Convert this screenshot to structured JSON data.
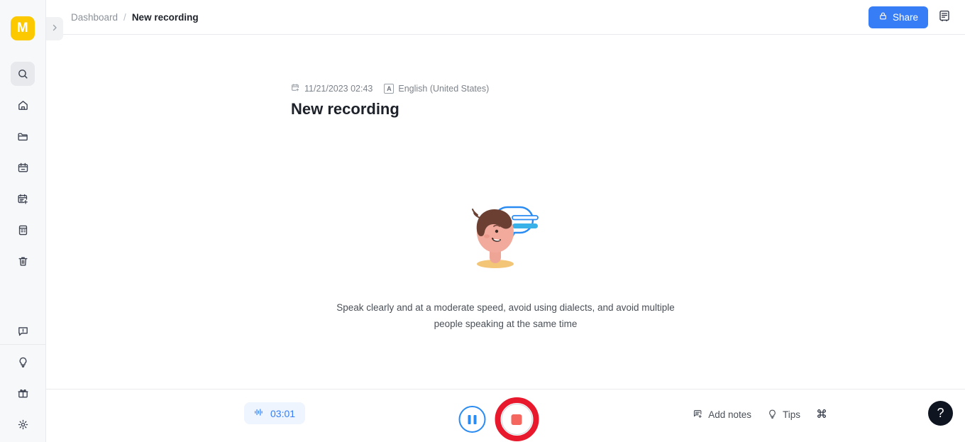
{
  "brand": {
    "logo_letter": "M",
    "logo_color": "#fcc800"
  },
  "sidebar": {
    "expand_icon": "chevron-right-icon",
    "top_items": [
      {
        "name": "search",
        "icon": "search-icon",
        "active": true
      },
      {
        "name": "home",
        "icon": "home-icon",
        "active": false
      },
      {
        "name": "folder",
        "icon": "folder-icon",
        "active": false
      },
      {
        "name": "calendar",
        "icon": "calendar-icon",
        "active": false
      },
      {
        "name": "new-meeting",
        "icon": "calendar-plus-icon",
        "active": false
      },
      {
        "name": "notes",
        "icon": "document-list-icon",
        "active": false
      },
      {
        "name": "trash",
        "icon": "trash-icon",
        "active": false
      }
    ],
    "bottom_items": [
      {
        "name": "feedback",
        "icon": "feedback-bubble-icon"
      },
      {
        "name": "whats-new",
        "icon": "lightbulb-icon"
      },
      {
        "name": "rewards",
        "icon": "gift-icon"
      },
      {
        "name": "settings",
        "icon": "gear-icon"
      }
    ]
  },
  "header": {
    "breadcrumb": {
      "root": "Dashboard",
      "separator": "/",
      "current": "New recording"
    },
    "share_label": "Share",
    "share_icon": "lock-icon",
    "share_color": "#377ef6",
    "panel_icon": "notes-panel-icon"
  },
  "recording": {
    "date": "11/21/2023 02:43",
    "date_icon": "calendar-plus-icon",
    "language": "English (United States)",
    "language_icon": "A",
    "title": "New recording",
    "hint": "Speak clearly and at a moderate speed, avoid using dialects, and avoid multiple people speaking at the same time",
    "illustration": "person-speaking-illustration"
  },
  "controls": {
    "timer": "03:01",
    "timer_icon": "waveform-icon",
    "timer_color": "#377ef6",
    "pause_label": "pause-button",
    "stop_label": "stop-recording-button",
    "stop_color": "#e8192c",
    "add_notes_label": "Add notes",
    "add_notes_icon": "note-plus-icon",
    "tips_label": "Tips",
    "tips_icon": "lightbulb-icon",
    "shortcuts_icon": "command-key-icon",
    "help_icon": "?"
  }
}
